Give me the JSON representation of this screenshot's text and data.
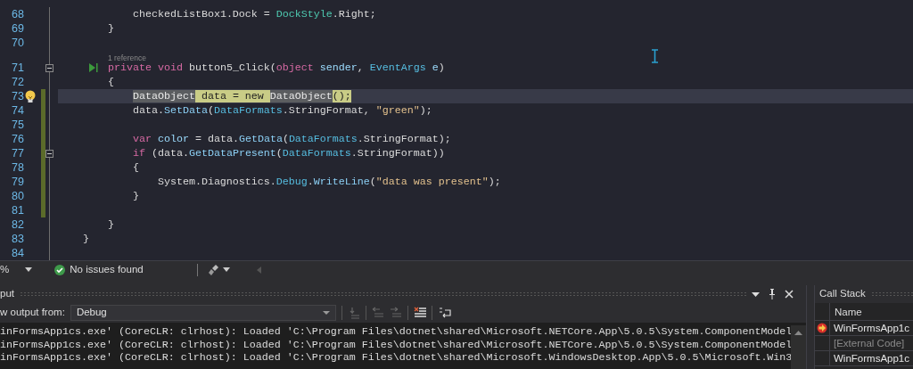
{
  "editor": {
    "lines": [
      {
        "number": "68",
        "changed": false,
        "fold": false,
        "current": false,
        "tokens": [
          {
            "kind": "plain",
            "text": "            checkedListBox1.Dock = "
          },
          {
            "kind": "enum",
            "text": "DockStyle"
          },
          {
            "kind": "plain",
            "text": ".Right;"
          }
        ]
      },
      {
        "number": "69",
        "changed": false,
        "fold": false,
        "current": false,
        "tokens": [
          {
            "kind": "plain",
            "text": "        }"
          }
        ]
      },
      {
        "number": "70",
        "changed": false,
        "fold": false,
        "current": false
      },
      {
        "number": "71",
        "changed": false,
        "fold": true,
        "current": false,
        "codelens": "1 reference",
        "gutter_icon": {
          "kind": "run"
        },
        "tokens": [
          {
            "kind": "keyword",
            "text": "        private"
          },
          {
            "kind": "keyword",
            "text": " void"
          },
          {
            "kind": "plain",
            "text": " button5_Click("
          },
          {
            "kind": "keyword",
            "text": "object"
          },
          {
            "kind": "param",
            "text": " sender"
          },
          {
            "kind": "plain",
            "text": ", "
          },
          {
            "kind": "class",
            "text": "EventArgs"
          },
          {
            "kind": "param",
            "text": " e"
          },
          {
            "kind": "plain",
            "text": ")"
          }
        ]
      },
      {
        "number": "72",
        "changed": false,
        "fold": false,
        "current": false,
        "tokens": [
          {
            "kind": "plain",
            "text": "        {"
          }
        ]
      },
      {
        "number": "73",
        "changed": true,
        "fold": false,
        "current": true,
        "gutter_icon": {
          "kind": "lightbulb"
        },
        "tokens": [
          {
            "kind": "reference",
            "text": "            DataObject"
          },
          {
            "kind": "write",
            "text": " data = new "
          },
          {
            "kind": "reference",
            "text": "DataObject"
          },
          {
            "kind": "write",
            "text": "();"
          }
        ]
      },
      {
        "number": "74",
        "changed": true,
        "fold": false,
        "current": false,
        "tokens": [
          {
            "kind": "plain",
            "text": "            data."
          },
          {
            "kind": "method",
            "text": "SetData"
          },
          {
            "kind": "plain",
            "text": "("
          },
          {
            "kind": "class",
            "text": "DataFormats"
          },
          {
            "kind": "plain",
            "text": ".StringFormat, "
          },
          {
            "kind": "string",
            "text": "\"green\""
          },
          {
            "kind": "plain",
            "text": ");"
          }
        ]
      },
      {
        "number": "75",
        "changed": true,
        "fold": false,
        "current": false
      },
      {
        "number": "76",
        "changed": true,
        "fold": false,
        "current": false,
        "tokens": [
          {
            "kind": "keyword",
            "text": "            var"
          },
          {
            "kind": "param",
            "text": " color"
          },
          {
            "kind": "plain",
            "text": " = data."
          },
          {
            "kind": "method",
            "text": "GetData"
          },
          {
            "kind": "plain",
            "text": "("
          },
          {
            "kind": "class",
            "text": "DataFormats"
          },
          {
            "kind": "plain",
            "text": ".StringFormat);"
          }
        ]
      },
      {
        "number": "77",
        "changed": true,
        "fold": true,
        "current": false,
        "tokens": [
          {
            "kind": "keyword",
            "text": "            if"
          },
          {
            "kind": "plain",
            "text": " (data."
          },
          {
            "kind": "method",
            "text": "GetDataPresent"
          },
          {
            "kind": "plain",
            "text": "("
          },
          {
            "kind": "class",
            "text": "DataFormats"
          },
          {
            "kind": "plain",
            "text": ".StringFormat))"
          }
        ]
      },
      {
        "number": "78",
        "changed": true,
        "fold": false,
        "current": false,
        "tokens": [
          {
            "kind": "plain",
            "text": "            {"
          }
        ]
      },
      {
        "number": "79",
        "changed": true,
        "fold": false,
        "current": false,
        "tokens": [
          {
            "kind": "plain",
            "text": "                System.Diagnostics."
          },
          {
            "kind": "class",
            "text": "Debug"
          },
          {
            "kind": "plain",
            "text": "."
          },
          {
            "kind": "method",
            "text": "WriteLine"
          },
          {
            "kind": "plain",
            "text": "("
          },
          {
            "kind": "string",
            "text": "\"data was present\""
          },
          {
            "kind": "plain",
            "text": ");"
          }
        ]
      },
      {
        "number": "80",
        "changed": true,
        "fold": false,
        "current": false,
        "tokens": [
          {
            "kind": "plain",
            "text": "            }"
          }
        ]
      },
      {
        "number": "81",
        "changed": true,
        "fold": false,
        "current": false
      },
      {
        "number": "82",
        "changed": false,
        "fold": false,
        "current": false,
        "tokens": [
          {
            "kind": "plain",
            "text": "        }"
          }
        ]
      },
      {
        "number": "83",
        "changed": false,
        "fold": false,
        "current": false,
        "tokens": [
          {
            "kind": "plain",
            "text": "    }"
          }
        ]
      },
      {
        "number": "84",
        "changed": false,
        "fold": false,
        "current": false
      }
    ]
  },
  "status_bar": {
    "zoom": "%",
    "issues": "No issues found"
  },
  "output": {
    "title": "put",
    "source_label": "w output from:",
    "source": "Debug",
    "lines": [
      "inFormsApp1cs.exe' (CoreCLR: clrhost): Loaded 'C:\\Program Files\\dotnet\\shared\\Microsoft.NETCore.App\\5.0.5\\System.ComponentModel",
      "inFormsApp1cs.exe' (CoreCLR: clrhost): Loaded 'C:\\Program Files\\dotnet\\shared\\Microsoft.NETCore.App\\5.0.5\\System.ComponentModel",
      "inFormsApp1cs.exe' (CoreCLR: clrhost): Loaded 'C:\\Program Files\\dotnet\\shared\\Microsoft.WindowsDesktop.App\\5.0.5\\Microsoft.Win3"
    ]
  },
  "call_stack": {
    "title": "Call Stack",
    "column": "Name",
    "rows": [
      {
        "name": "WinFormsApp1c",
        "current": true,
        "external": false
      },
      {
        "name": "[External Code]",
        "current": false,
        "external": true
      },
      {
        "name": "WinFormsApp1c",
        "current": false,
        "external": false
      }
    ]
  }
}
